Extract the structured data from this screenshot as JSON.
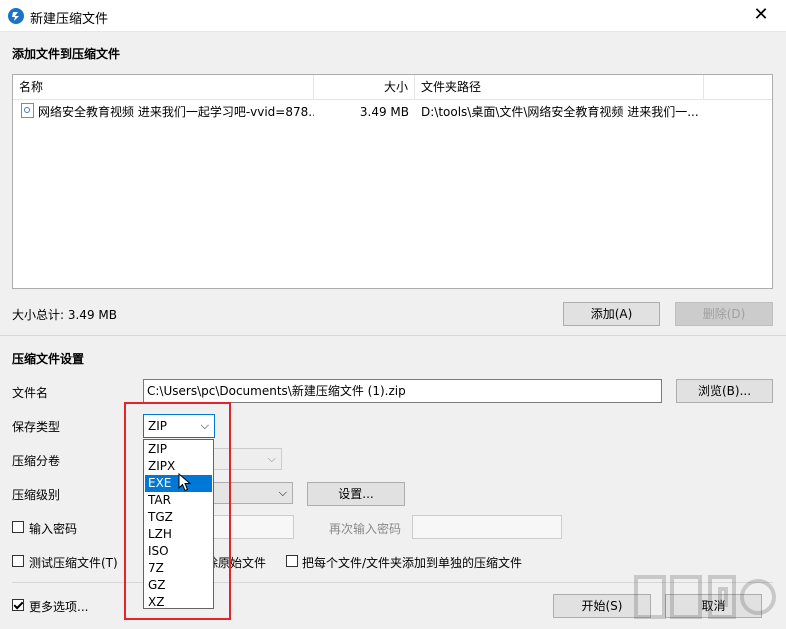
{
  "window": {
    "title": "新建压缩文件",
    "close_glyph": "✕"
  },
  "add_section": {
    "title": "添加文件到压缩文件",
    "columns": {
      "name": "名称",
      "size": "大小",
      "path": "文件夹路径"
    },
    "rows": [
      {
        "name": "网络安全教育视频 进来我们一起学习吧-vvid=878...",
        "size": "3.49 MB",
        "path": "D:\\tools\\桌面\\文件\\网络安全教育视频 进来我们一..."
      }
    ],
    "total": "大小总计: 3.49 MB",
    "add_button": "添加(A)",
    "delete_button": "删除(D)"
  },
  "settings": {
    "title": "压缩文件设置",
    "filename_label": "文件名",
    "filename_value": "C:\\Users\\pc\\Documents\\新建压缩文件 (1).zip",
    "browse_button": "浏览(B)...",
    "save_type_label": "保存类型",
    "save_type_value": "ZIP",
    "split_label": "压缩分卷",
    "level_label": "压缩级别",
    "level_settings_button": "设置...",
    "password_label": "输入密码",
    "password_again_label": "再次输入密码",
    "test_label": "测试压缩文件(T)",
    "delete_original_label": "除原始文件",
    "each_separate_label": "把每个文件/文件夹添加到单独的压缩文件",
    "more_options_label": "更多选项...",
    "start_button": "开始(S)",
    "cancel_button": "取消"
  },
  "dropdown": {
    "options": [
      "ZIP",
      "ZIPX",
      "EXE",
      "TAR",
      "TGZ",
      "LZH",
      "ISO",
      "7Z",
      "GZ",
      "XZ"
    ],
    "highlighted_index": 2
  },
  "colors": {
    "highlight": "#0078d7",
    "annotation": "#e0262c"
  }
}
